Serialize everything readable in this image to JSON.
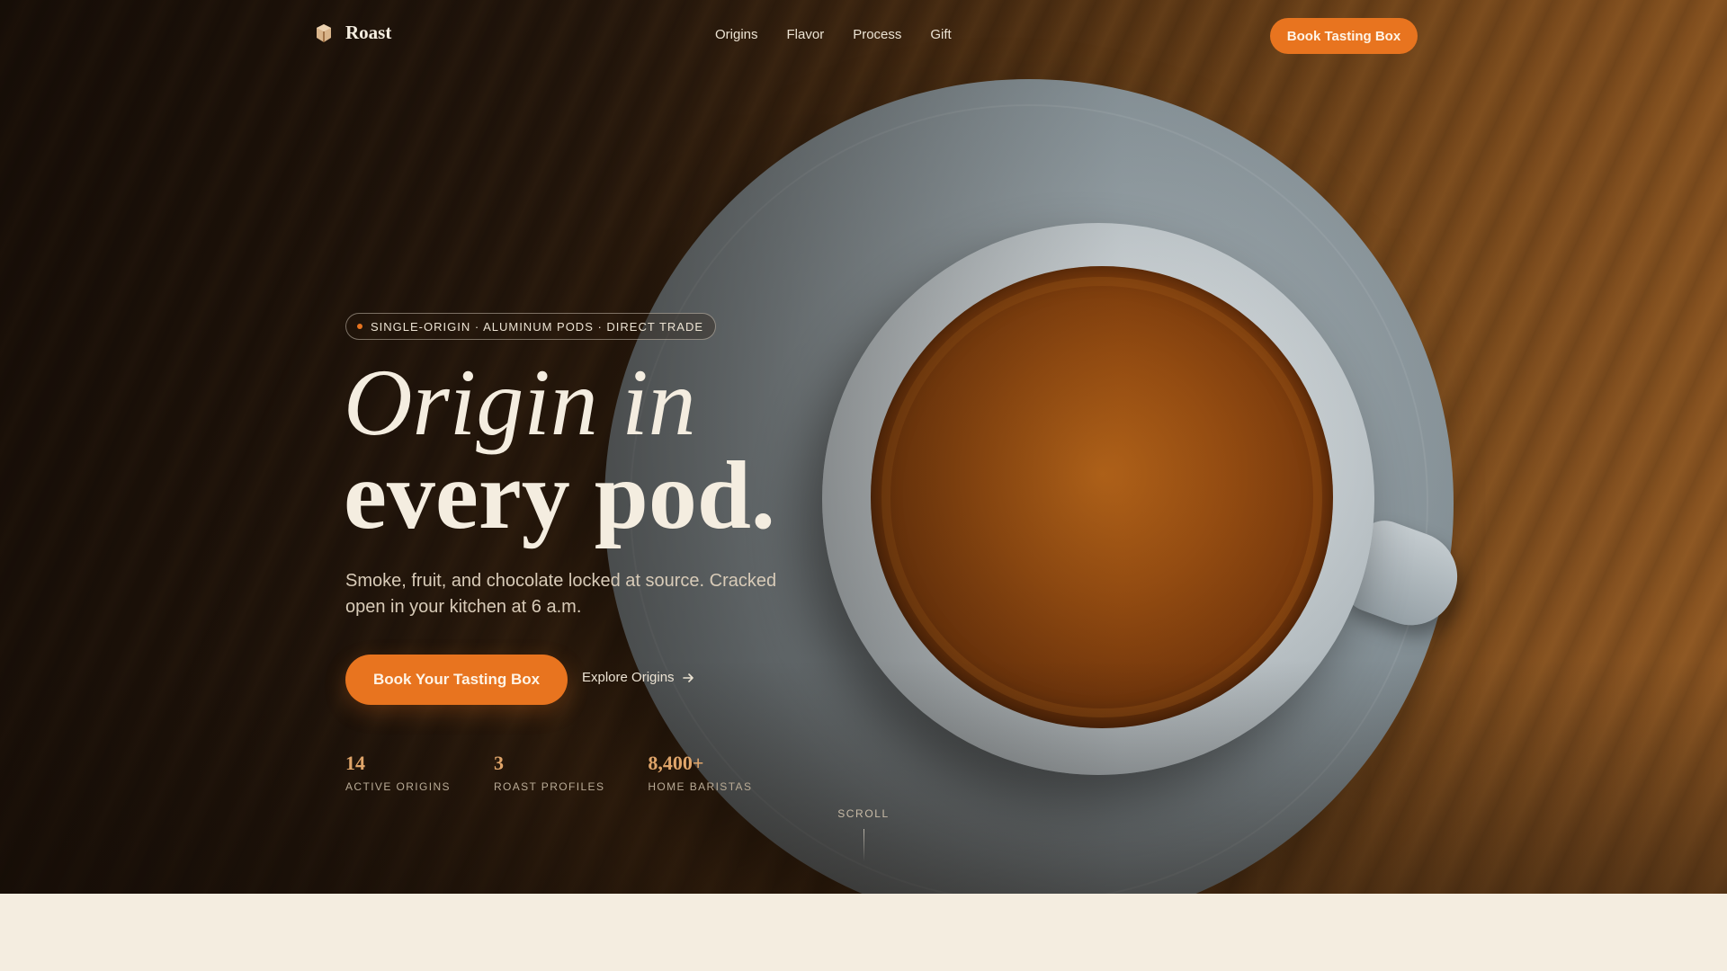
{
  "nav": {
    "brand": "Roast",
    "brand_icon": "coffee-bean-icon",
    "links": [
      "Origins",
      "Flavor",
      "Process",
      "Gift"
    ],
    "cta": "Book Tasting Box"
  },
  "hero": {
    "tag": "SINGLE-ORIGIN · ALUMINUM PODS · DIRECT TRADE",
    "headline_line1": "Origin in",
    "headline_line2": "every pod.",
    "subcopy": "Smoke, fruit, and chocolate locked at source. Cracked open in your kitchen at 6 a.m.",
    "primary_cta": "Book Your Tasting Box",
    "secondary_cta": "Explore Origins",
    "secondary_cta_icon": "arrow-right-icon",
    "stats": [
      {
        "value": "14",
        "label": "ACTIVE ORIGINS"
      },
      {
        "value": "3",
        "label": "ROAST PROFILES"
      },
      {
        "value": "8,400+",
        "label": "HOME BARISTAS"
      }
    ],
    "scroll_label": "SCROLL"
  },
  "colors": {
    "accent": "#e8741f",
    "cream": "#f4ede0",
    "stat_value": "#e0a56a",
    "dark_bg": "#2e1d0f"
  }
}
